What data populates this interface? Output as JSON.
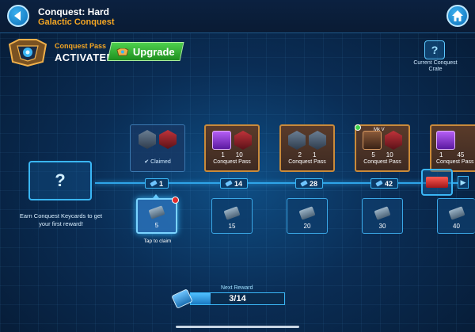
{
  "header": {
    "title": "Conquest: Hard",
    "subtitle": "Galactic Conquest"
  },
  "pass": {
    "label": "Conquest Pass",
    "status": "ACTIVATED",
    "upgrade_label": "Upgrade"
  },
  "crate": {
    "label": "Current Conquest Crate"
  },
  "start": {
    "text": "Earn Conquest Keycards to get your first reward!"
  },
  "tiers": [
    {
      "keycards": "1",
      "type": "claimed",
      "label": "Claimed",
      "qty_a": "",
      "qty_b": "",
      "reward_qty": "5",
      "reward_note": "Tap to claim"
    },
    {
      "keycards": "14",
      "type": "pass",
      "label": "Conquest Pass",
      "qty_a": "1",
      "qty_b": "10",
      "reward_qty": "15"
    },
    {
      "keycards": "28",
      "type": "pass",
      "label": "Conquest Pass",
      "qty_a": "2",
      "qty_b": "1",
      "reward_qty": "20"
    },
    {
      "keycards": "42",
      "type": "pass",
      "label": "Conquest Pass",
      "qty_a": "5",
      "qty_b": "10",
      "reward_qty": "30",
      "badge": "Mk V"
    },
    {
      "keycards": "",
      "type": "pass",
      "label": "Conquest Pass",
      "qty_a": "1",
      "qty_b": "45",
      "reward_qty": "40"
    }
  ],
  "progress": {
    "label": "Next Reward",
    "text": "3/14",
    "fraction": 0.214
  },
  "colors": {
    "accent": "#3ab6f5",
    "gold": "#f5a623",
    "upgrade_green": "#2ea82e"
  }
}
